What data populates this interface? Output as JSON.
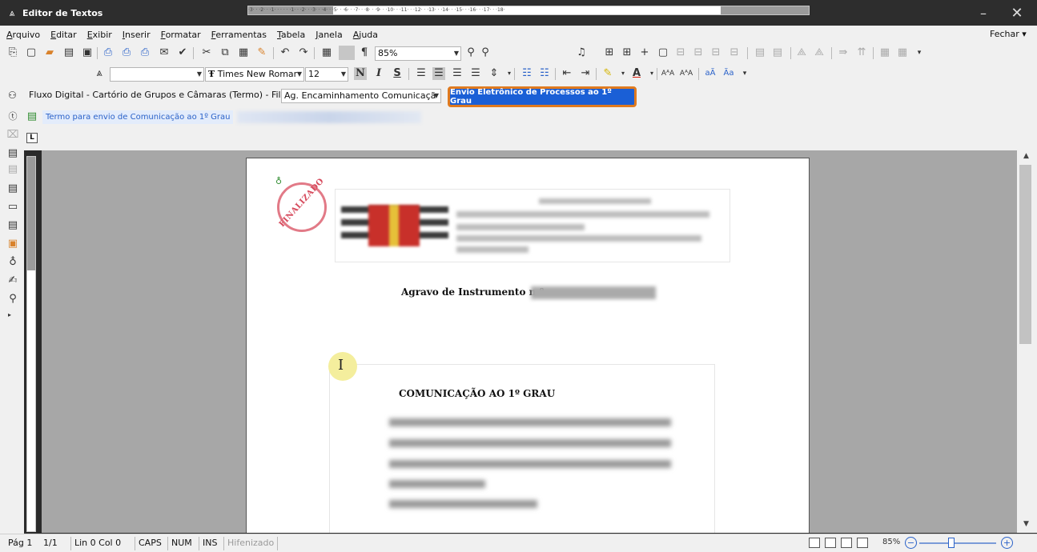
{
  "window": {
    "title": "Editor de Textos"
  },
  "menu": {
    "items": [
      "Arquivo",
      "Editar",
      "Exibir",
      "Inserir",
      "Formatar",
      "Ferramentas",
      "Tabela",
      "Janela",
      "Ajuda"
    ],
    "close_label": "Fechar"
  },
  "toolbar": {
    "zoom_value": "85%",
    "font_name": "Times New Romar",
    "font_size": "12",
    "style_value": ""
  },
  "fluxo": {
    "label": "Fluxo Digital - Cartório de Grupos e Câmaras (Termo) - Fila:",
    "fila_value": "Ag. Encaminhamento Comunicaçã",
    "action_button": "Envio Eletrônico de Processos ao 1º Grau"
  },
  "document_tab": {
    "label": "Termo para envio de Comunicação ao 1º Grau"
  },
  "ruler": {
    "marks": "·3· · ·2· · ·1· · · · · ·1· · ·2· · ·3· · ·4· · ·5· · ·6· · ·7· · ·8· · ·9· · ·10· · ·11· · ·12· · ·13· · ·14· · ·15· · ·16· · ·17· · ·18·"
  },
  "document": {
    "stamp_text": "FINALIZADO",
    "agravo_label": "Agravo de Instrumento n.º",
    "section_title": "COMUNICAÇÃO AO 1º GRAU"
  },
  "status": {
    "page": "Pág 1",
    "pages": "1/1",
    "line_col": "Lin 0  Col 0",
    "caps": "CAPS",
    "num": "NUM",
    "ins": "INS",
    "hyphen": "Hifenizado",
    "zoom": "85%"
  },
  "colors": {
    "action_button_bg": "#1a5fd6",
    "action_button_border": "#e07a1f",
    "stamp": "#d64a5c"
  }
}
